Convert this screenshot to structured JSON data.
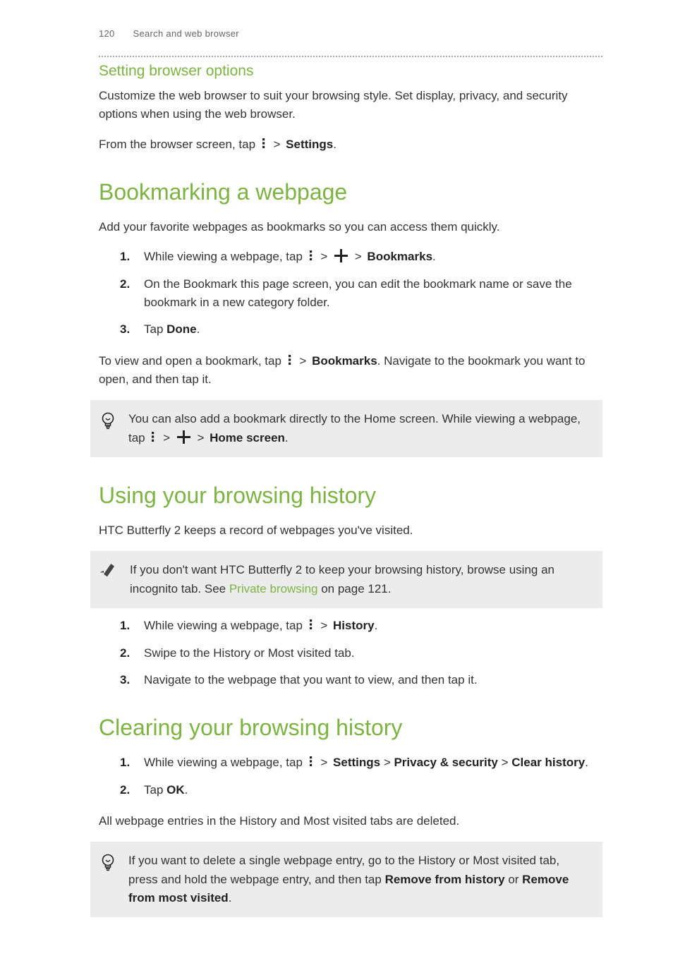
{
  "header": {
    "page_number": "120",
    "section": "Search and web browser"
  },
  "s1": {
    "title": "Setting browser options",
    "p1": "Customize the web browser to suit your browsing style. Set display, privacy, and security options when using the web browser.",
    "p2a": "From the browser screen, tap ",
    "p2b": " > ",
    "p2c": "Settings",
    "p2d": "."
  },
  "s2": {
    "title": "Bookmarking a webpage",
    "p1": "Add your favorite webpages as bookmarks so you can access them quickly.",
    "li1a": "While viewing a webpage, tap ",
    "li1b": " > ",
    "li1c": " > ",
    "li1d": "Bookmarks",
    "li1e": ".",
    "li2": "On the Bookmark this page screen, you can edit the bookmark name or save the bookmark in a new category folder.",
    "li3a": "Tap ",
    "li3b": "Done",
    "li3c": ".",
    "p2a": "To view and open a bookmark, tap ",
    "p2b": " > ",
    "p2c": "Bookmarks",
    "p2d": ". Navigate to the bookmark you want to open, and then tap it.",
    "tip_a": "You can also add a bookmark directly to the Home screen. While viewing a webpage, tap ",
    "tip_b": " > ",
    "tip_c": " > ",
    "tip_d": "Home screen",
    "tip_e": "."
  },
  "s3": {
    "title": "Using your browsing history",
    "p1": "HTC Butterfly 2 keeps a record of webpages you've visited.",
    "tip_a": "If you don't want HTC Butterfly 2 to keep your browsing history, browse using an incognito tab. See ",
    "tip_link": "Private browsing",
    "tip_b": " on page 121.",
    "li1a": "While viewing a webpage, tap ",
    "li1b": " > ",
    "li1c": "History",
    "li1d": ".",
    "li2": "Swipe to the History or Most visited tab.",
    "li3": "Navigate to the webpage that you want to view, and then tap it."
  },
  "s4": {
    "title": "Clearing your browsing history",
    "li1a": "While viewing a webpage, tap ",
    "li1b": " > ",
    "li1c": "Settings",
    "li1d": " > ",
    "li1e": "Privacy & security",
    "li1f": " > ",
    "li1g": "Clear history",
    "li1h": ".",
    "li2a": "Tap ",
    "li2b": "OK",
    "li2c": ".",
    "p1": "All webpage entries in the History and Most visited tabs are deleted.",
    "tip_a": "If you want to delete a single webpage entry, go to the History or Most visited tab, press and hold the webpage entry, and then tap ",
    "tip_b": "Remove from history",
    "tip_c": " or ",
    "tip_d": "Remove from most visited",
    "tip_e": "."
  }
}
